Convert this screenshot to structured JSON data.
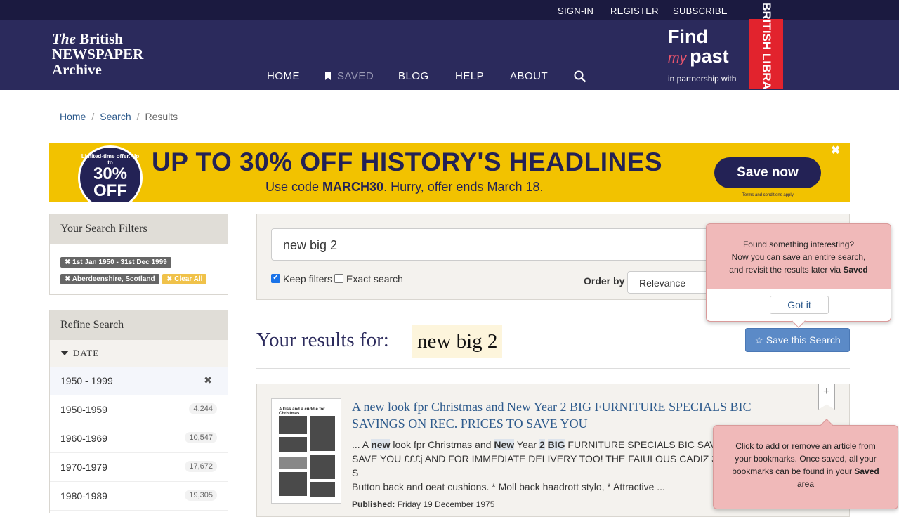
{
  "topbar": {
    "sign_in": "SIGN-IN",
    "register": "REGISTER",
    "subscribe": "SUBSCRIBE"
  },
  "logo": {
    "line1_the": "The",
    "line1_rest": " British",
    "line2": "NEWSPAPER",
    "line3": "Archive"
  },
  "nav": {
    "home": "HOME",
    "saved": "SAVED",
    "blog": "BLOG",
    "help": "HELP",
    "about": "ABOUT"
  },
  "partner": {
    "find": "Find",
    "my": "my",
    "past": "past",
    "partnership": "in partnership with",
    "library": "BRITISH LIBRARY"
  },
  "breadcrumb": {
    "home": "Home",
    "search": "Search",
    "current": "Results"
  },
  "banner": {
    "disc_text": "Limited-time offer. Up to",
    "disc_pct": "30%",
    "disc_off": "OFF",
    "headline": "UP TO 30% OFF HISTORY'S HEADLINES",
    "code_prefix": "Use code ",
    "code": "MARCH30",
    "code_suffix": ". Hurry, offer ends March 18.",
    "cta": "Save now",
    "terms": "Terms and conditions apply",
    "close": "✖"
  },
  "filters": {
    "title": "Your Search Filters",
    "tags": [
      "1st Jan 1950 - 31st Dec 1999",
      "Aberdeenshire, Scotland"
    ],
    "clear_all": "Clear All"
  },
  "refine": {
    "title": "Refine Search",
    "date_heading": "DATE",
    "selected": "1950 - 1999",
    "decades": [
      {
        "label": "1950-1959",
        "count": "4,244"
      },
      {
        "label": "1960-1969",
        "count": "10,547"
      },
      {
        "label": "1970-1979",
        "count": "17,672"
      },
      {
        "label": "1980-1989",
        "count": "19,305"
      }
    ]
  },
  "search": {
    "query": "new big 2",
    "keep_filters": "Keep filters",
    "exact_search": "Exact search",
    "order_by_label": "Order by",
    "order_by_value": "Relevance"
  },
  "results": {
    "heading": "Your results for:",
    "query": "new big 2",
    "save_search": "Save this Search"
  },
  "result1": {
    "thumb_caption": "A kiss and a cuddle for Christmas",
    "title": "A new look fpr Christmas and New Year 2 BIG FURNITURE SPECIALS BIC SAVINGS ON REC. PRICES TO SAVE YOU",
    "snippet_parts": [
      "... A ",
      "new",
      " look fpr Christmas and ",
      "New",
      " Year ",
      "2",
      " ",
      "BIG",
      " FURNITURE SPECIALS BIC SAV"
    ],
    "snippet_line2": "SAVE YOU £££j AND FOR IMMEDIATE DELIVERY TOO! THE FAIULOUS CADIZ 3 S",
    "snippet_line3": "Button back and oeat cushions. * Moll back haadrott stylo, * Attractive ...",
    "published_label": "Published:",
    "published_value": "Friday 19 December 1975",
    "bookmark": "+"
  },
  "popover_search": {
    "line1": "Found something interesting?",
    "line2": "Now you can save an entire search,",
    "line3": "and revisit the results later via ",
    "line3_bold": "Saved",
    "button": "Got it"
  },
  "popover_bookmark": {
    "text": "Click to add or remove an article from your bookmarks. Once saved, all your bookmarks can be found in your ",
    "bold": "Saved",
    "suffix": " area"
  },
  "colors": {
    "header": "#2b2a5c",
    "topbar": "#1b1a40",
    "banner": "#f2c200",
    "link": "#2d5a8c",
    "popover": "#f0b9b9",
    "save_button": "#5b8ac7"
  }
}
